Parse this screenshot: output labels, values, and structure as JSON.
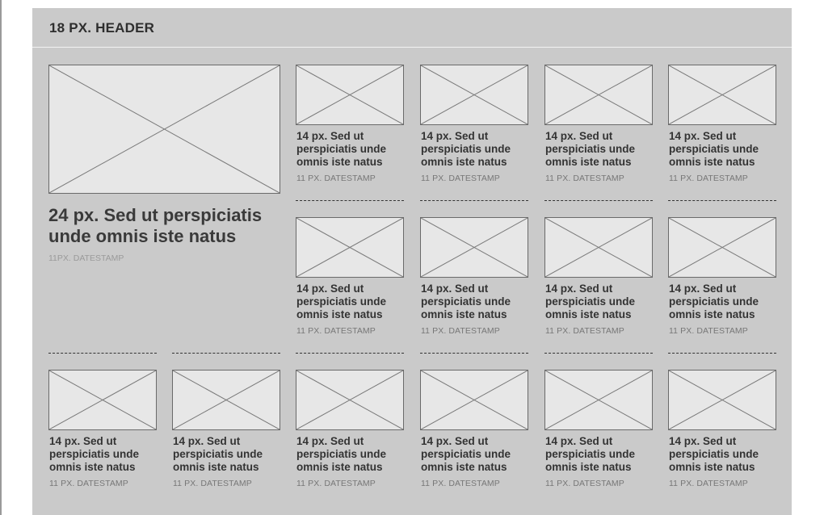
{
  "header": {
    "title": "18 PX. HEADER"
  },
  "featured": {
    "title": "24 px. Sed ut perspiciatis unde omnis iste natus",
    "datestamp": "11PX. DATESTAMP"
  },
  "cards": {
    "title": "14 px. Sed ut perspiciatis unde omnis iste natus",
    "datestamp": "11 PX. DATESTAMP"
  }
}
